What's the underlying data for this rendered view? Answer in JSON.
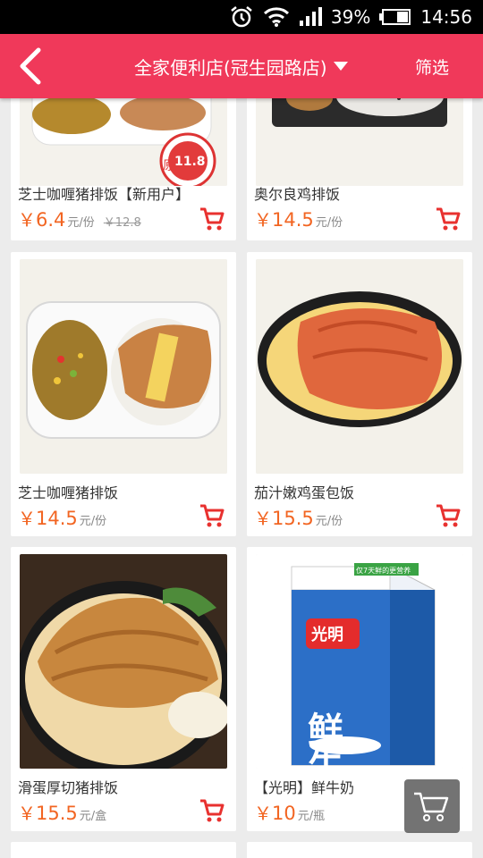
{
  "status_bar": {
    "battery": "39%",
    "time": "14:56",
    "icons": [
      "alarm-icon",
      "wifi-icon",
      "signal-icon",
      "battery-icon"
    ]
  },
  "header": {
    "title": "全家便利店(冠生园路店)",
    "filter_label": "筛选",
    "back_icon": "back-arrow-icon",
    "dropdown_icon": "caret-down-icon",
    "background_color": "#f0395a"
  },
  "products": [
    {
      "name": "芝士咖喱猪排饭【新用户】",
      "currency": "￥",
      "price": "6.4",
      "unit": "元/份",
      "original_price": "￥12.8",
      "badge": "11.8",
      "badge_prefix": "原"
    },
    {
      "name": "奥尔良鸡排饭",
      "currency": "￥",
      "price": "14.5",
      "unit": "元/份"
    },
    {
      "name": "芝士咖喱猪排饭",
      "currency": "￥",
      "price": "14.5",
      "unit": "元/份"
    },
    {
      "name": "茄汁嫩鸡蛋包饭",
      "currency": "￥",
      "price": "15.5",
      "unit": "元/份"
    },
    {
      "name": "滑蛋厚切猪排饭",
      "currency": "￥",
      "price": "15.5",
      "unit": "元/盒"
    },
    {
      "name": "【光明】鲜牛奶",
      "currency": "￥",
      "price": "10",
      "unit": "元/瓶",
      "carton_brand": "光明",
      "carton_text": "鲜牛奶",
      "carton_banner": "仅7天鲜的更营养"
    }
  ],
  "colors": {
    "accent": "#f0395a",
    "price": "#f26522",
    "cart": "#e8312f"
  }
}
